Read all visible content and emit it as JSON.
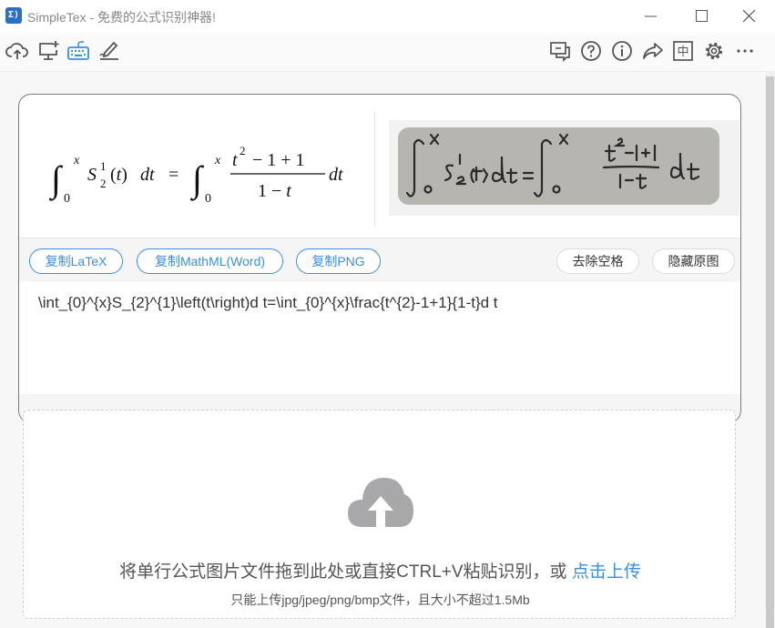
{
  "window": {
    "logo_text": "Σ)",
    "title": "SimpleTex - 免费的公式识别神器!"
  },
  "toolbar": {
    "left_icons": [
      "cloud-upload-icon",
      "screen-capture-icon",
      "keyboard-icon",
      "handwriting-icon"
    ],
    "right_icons": [
      "feedback-icon",
      "help-icon",
      "info-icon",
      "share-icon",
      "language-icon",
      "settings-icon",
      "more-icon"
    ],
    "language_label": "中"
  },
  "result": {
    "rendered_formula": "∫₀ˣ S₂¹(t) dt = ∫₀ˣ (t²−1+1)/(1−t) dt",
    "buttons": {
      "copy_latex": "复制LaTeX",
      "copy_mathml": "复制MathML(Word)",
      "copy_png": "复制PNG",
      "remove_spaces": "去除空格",
      "hide_original": "隐藏原图"
    },
    "latex_code": "\\int_{0}^{x}S_{2}^{1}\\left(t\\right)d t=\\int_{0}^{x}\\frac{t^{2}-1+1}{1-t}d t"
  },
  "upload": {
    "main_text": "将单行公式图片文件拖到此处或直接CTRL+V粘贴识别，或 ",
    "link_text": "点击上传",
    "note": "只能上传jpg/jpeg/png/bmp文件，且大小不超过1.5Mb"
  },
  "colors": {
    "accent": "#3a8ee6",
    "logo": "#2b6fc5"
  }
}
